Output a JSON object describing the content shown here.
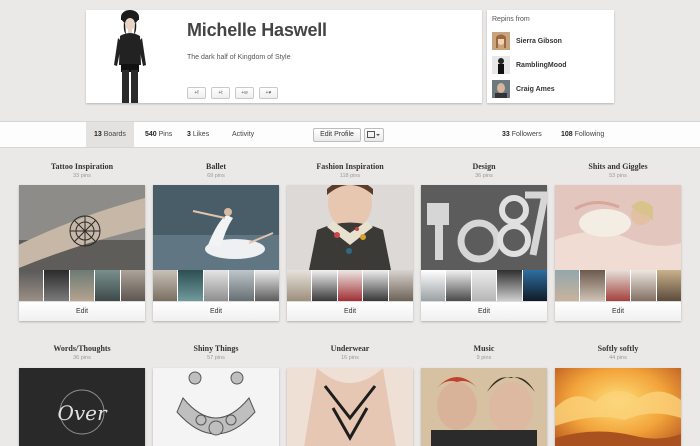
{
  "profile": {
    "name": "Michelle Haswell",
    "about": "The dark half of Kingdom of Style",
    "social_buttons": [
      "+f",
      "+t",
      "+w",
      "+♥"
    ]
  },
  "repins": {
    "title": "Repins from",
    "users": [
      {
        "name": "Sierra Gibson"
      },
      {
        "name": "RamblingMood"
      },
      {
        "name": "Craig Ames"
      }
    ]
  },
  "stats": {
    "boards_num": "13",
    "boards_label": "Boards",
    "pins_num": "540",
    "pins_label": "Pins",
    "likes_num": "3",
    "likes_label": "Likes",
    "activity_label": "Activity",
    "edit_profile_label": "Edit Profile",
    "followers_num": "33",
    "followers_label": "Followers",
    "following_num": "108",
    "following_label": "Following"
  },
  "edit_label": "Edit",
  "boards": [
    {
      "title": "Tattoo Inspiration",
      "count": "33 pins"
    },
    {
      "title": "Ballet",
      "count": "69 pins"
    },
    {
      "title": "Fashion Inspiration",
      "count": "118 pins"
    },
    {
      "title": "Design",
      "count": "36 pins"
    },
    {
      "title": "Shits and Giggles",
      "count": "53 pins"
    },
    {
      "title": "Words/Thoughts",
      "count": "36 pins"
    },
    {
      "title": "Shiny Things",
      "count": "57 pins"
    },
    {
      "title": "Underwear",
      "count": "16 pins"
    },
    {
      "title": "Music",
      "count": "9 pins"
    },
    {
      "title": "Softly softly",
      "count": "44 pins"
    }
  ],
  "colors": {
    "background": "#ebe9e7",
    "card": "#ffffff",
    "text": "#333333"
  }
}
